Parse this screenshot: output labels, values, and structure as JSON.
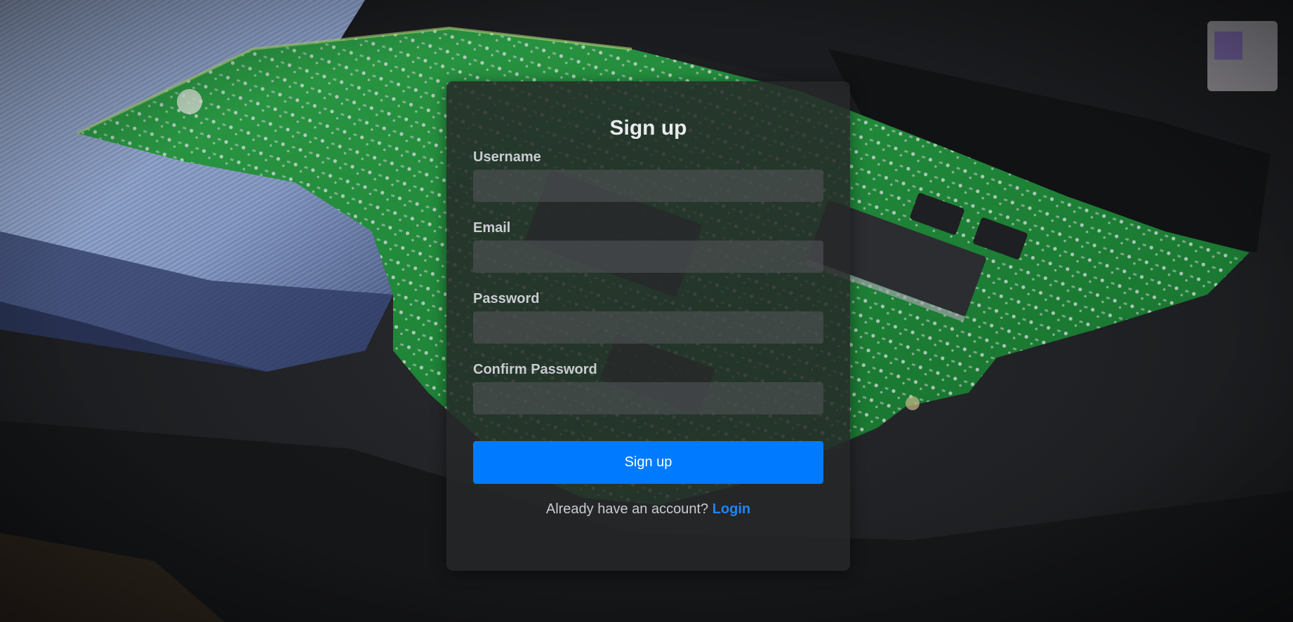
{
  "form": {
    "title": "Sign up",
    "fields": [
      {
        "label": "Username",
        "value": "",
        "type": "text"
      },
      {
        "label": "Email",
        "value": "",
        "type": "email"
      },
      {
        "label": "Password",
        "value": "",
        "type": "password"
      },
      {
        "label": "Confirm Password",
        "value": "",
        "type": "password"
      }
    ],
    "submit_label": "Sign up",
    "footer_text": "Already have an account?",
    "login_link": "Login"
  },
  "colors": {
    "accent": "#007bff",
    "link": "#1a86ff",
    "card_bg": "rgba(38,39,41,0.84)",
    "pcb_green": "#1f8a3a"
  },
  "background": {
    "subject": "green circuit board on dark surface with blue fabric"
  }
}
